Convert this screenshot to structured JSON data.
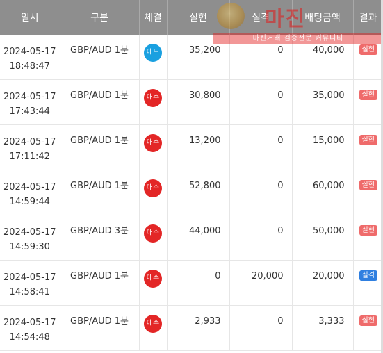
{
  "columns": [
    "일시",
    "구분",
    "체결",
    "실현",
    "실격",
    "배팅금액",
    "결과"
  ],
  "watermark": {
    "title": "마진",
    "subtitle": "마진거래 검증전문 커뮤니티"
  },
  "rows": [
    {
      "date": "2024-05-17",
      "time": "18:48:47",
      "kind": "GBP/AUD 1분",
      "side": "매도",
      "side_type": "sell",
      "profit": "35,200",
      "loss": "0",
      "bet": "40,000",
      "result": "실현",
      "result_type": "win"
    },
    {
      "date": "2024-05-17",
      "time": "17:43:44",
      "kind": "GBP/AUD 1분",
      "side": "매수",
      "side_type": "buy",
      "profit": "30,800",
      "loss": "0",
      "bet": "35,000",
      "result": "실현",
      "result_type": "win"
    },
    {
      "date": "2024-05-17",
      "time": "17:11:42",
      "kind": "GBP/AUD 1분",
      "side": "매수",
      "side_type": "buy",
      "profit": "13,200",
      "loss": "0",
      "bet": "15,000",
      "result": "실현",
      "result_type": "win"
    },
    {
      "date": "2024-05-17",
      "time": "14:59:44",
      "kind": "GBP/AUD 1분",
      "side": "매수",
      "side_type": "buy",
      "profit": "52,800",
      "loss": "0",
      "bet": "60,000",
      "result": "실현",
      "result_type": "win"
    },
    {
      "date": "2024-05-17",
      "time": "14:59:30",
      "kind": "GBP/AUD 3분",
      "side": "매수",
      "side_type": "buy",
      "profit": "44,000",
      "loss": "0",
      "bet": "50,000",
      "result": "실현",
      "result_type": "win"
    },
    {
      "date": "2024-05-17",
      "time": "14:58:41",
      "kind": "GBP/AUD 1분",
      "side": "매수",
      "side_type": "buy",
      "profit": "0",
      "loss": "20,000",
      "bet": "20,000",
      "result": "실격",
      "result_type": "loss"
    },
    {
      "date": "2024-05-17",
      "time": "14:54:48",
      "kind": "GBP/AUD 1분",
      "side": "매수",
      "side_type": "buy",
      "profit": "2,933",
      "loss": "0",
      "bet": "3,333",
      "result": "실현",
      "result_type": "win"
    }
  ]
}
